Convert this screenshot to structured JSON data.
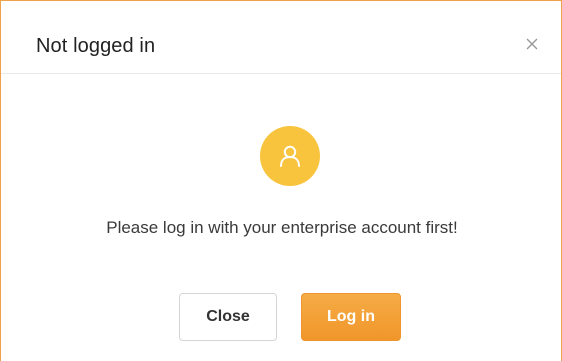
{
  "dialog": {
    "title": "Not logged in",
    "message": "Please log in with your enterprise account first!",
    "close_button_label": "Close",
    "login_button_label": "Log in",
    "icons": {
      "close": "close-x-icon",
      "user": "user-icon"
    },
    "colors": {
      "accent": "#f0962a",
      "avatar_bg": "#f8c43d",
      "border": "#f0a24a"
    }
  }
}
